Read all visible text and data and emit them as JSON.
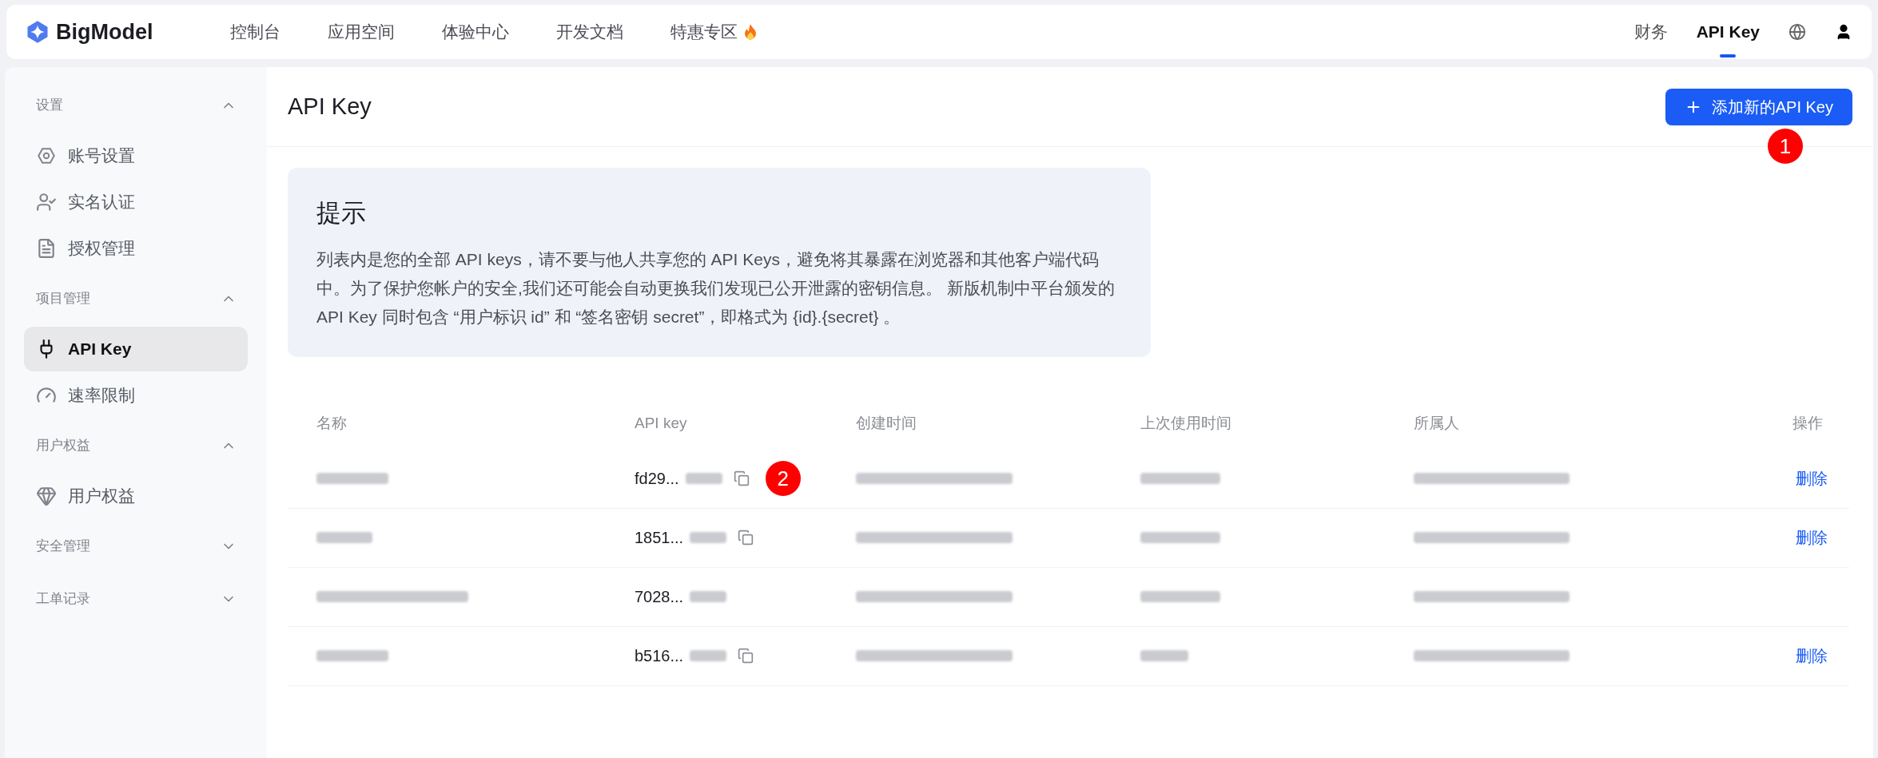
{
  "brand": {
    "name": "BigModel"
  },
  "nav": [
    {
      "label": "控制台",
      "hot": false
    },
    {
      "label": "应用空间",
      "hot": false
    },
    {
      "label": "体验中心",
      "hot": false
    },
    {
      "label": "开发文档",
      "hot": false
    },
    {
      "label": "特惠专区",
      "hot": true
    }
  ],
  "nav_right": [
    {
      "label": "财务",
      "selected": false
    },
    {
      "label": "API Key",
      "selected": true
    }
  ],
  "sidebar": [
    {
      "title": "设置",
      "expanded": true,
      "items": [
        {
          "label": "账号设置",
          "selected": false
        },
        {
          "label": "实名认证",
          "selected": false
        },
        {
          "label": "授权管理",
          "selected": false
        }
      ]
    },
    {
      "title": "项目管理",
      "expanded": true,
      "items": [
        {
          "label": "API Key",
          "selected": true
        },
        {
          "label": "速率限制",
          "selected": false
        }
      ]
    },
    {
      "title": "用户权益",
      "expanded": true,
      "items": [
        {
          "label": "用户权益",
          "selected": false
        }
      ]
    },
    {
      "title": "安全管理",
      "expanded": false
    },
    {
      "title": "工单记录",
      "expanded": false
    }
  ],
  "page": {
    "title": "API Key",
    "add_button": "添加新的API Key",
    "badge": "1"
  },
  "notice": {
    "title": "提示",
    "text": "列表内是您的全部 API keys，请不要与他人共享您的 API Keys，避免将其暴露在浏览器和其他客户端代码中。为了保护您帐户的安全,我们还可能会自动更换我们发现已公开泄露的密钥信息。 新版机制中平台颁发的 API Key 同时包含 “用户标识 id” 和 “签名密钥 secret”，即格式为 {id}.{secret} 。"
  },
  "table": {
    "columns": [
      "名称",
      "API key",
      "创建时间",
      "上次使用时间",
      "所属人",
      "操作"
    ],
    "rows": [
      {
        "key": "fd29...",
        "copyable": true,
        "action": "删除",
        "badge": "2"
      },
      {
        "key": "1851...",
        "copyable": true,
        "action": "删除"
      },
      {
        "key": "7028...",
        "copyable": false
      },
      {
        "key": "b516...",
        "copyable": true,
        "action": "删除"
      }
    ]
  }
}
